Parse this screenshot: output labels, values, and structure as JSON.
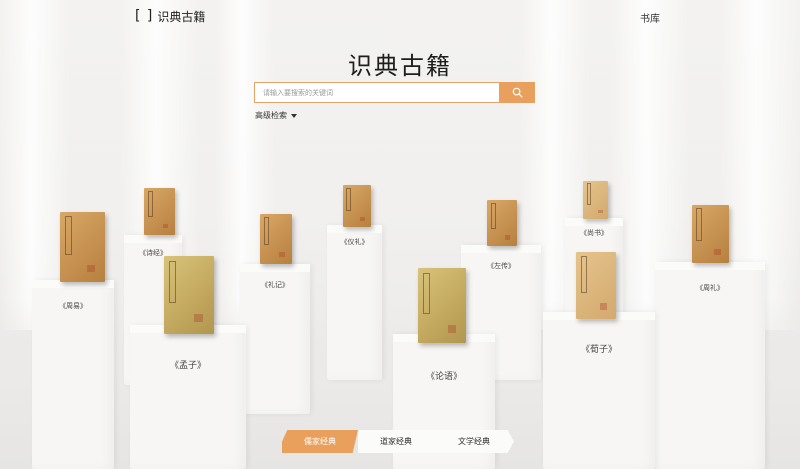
{
  "header": {
    "logo_mark": "[ ]",
    "logo_text": "识典古籍",
    "library_label": "书库"
  },
  "main": {
    "title": "识典古籍",
    "search_placeholder": "请输入要搜索的关键词",
    "advanced_search_label": "高级检索"
  },
  "shelf": {
    "books": [
      {
        "label": "《周易》"
      },
      {
        "label": "《尚书》"
      },
      {
        "label": "《论语》"
      },
      {
        "label": "《左传》"
      },
      {
        "label": "《诗经》"
      },
      {
        "label": "《周礼》"
      },
      {
        "label": "《礼记》"
      },
      {
        "label": "《仪礼》"
      },
      {
        "label": "《孟子》"
      },
      {
        "label": "《荀子》"
      }
    ]
  },
  "tabs": [
    {
      "label": "儒家经典",
      "active": true
    },
    {
      "label": "道家经典",
      "active": false
    },
    {
      "label": "文学经典",
      "active": false
    }
  ],
  "colors": {
    "accent": "#e8a05c",
    "background": "#f2f1ef"
  }
}
